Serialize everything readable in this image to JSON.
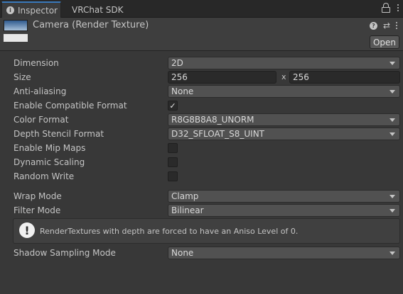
{
  "tabs": [
    {
      "label": "Inspector",
      "active": true
    },
    {
      "label": "VRChat SDK",
      "active": false
    }
  ],
  "header": {
    "title": "Camera (Render Texture)",
    "open_label": "Open"
  },
  "properties": {
    "dimension": {
      "label": "Dimension",
      "value": "2D"
    },
    "size": {
      "label": "Size",
      "width": "256",
      "separator": "x",
      "height": "256"
    },
    "anti_aliasing": {
      "label": "Anti-aliasing",
      "value": "None"
    },
    "enable_compatible_format": {
      "label": "Enable Compatible Format",
      "checked": true
    },
    "color_format": {
      "label": "Color Format",
      "value": "R8G8B8A8_UNORM"
    },
    "depth_stencil_format": {
      "label": "Depth Stencil Format",
      "value": "D32_SFLOAT_S8_UINT"
    },
    "enable_mip_maps": {
      "label": "Enable Mip Maps",
      "checked": false
    },
    "dynamic_scaling": {
      "label": "Dynamic Scaling",
      "checked": false
    },
    "random_write": {
      "label": "Random Write",
      "checked": false
    },
    "wrap_mode": {
      "label": "Wrap Mode",
      "value": "Clamp"
    },
    "filter_mode": {
      "label": "Filter Mode",
      "value": "Bilinear"
    },
    "shadow_sampling_mode": {
      "label": "Shadow Sampling Mode",
      "value": "None"
    }
  },
  "help": {
    "message": "RenderTextures with depth are forced to have an Aniso Level of 0."
  },
  "glyphs": {
    "info": "i",
    "help": "?",
    "sliders": "⇄",
    "check": "✓",
    "warning": "!"
  },
  "colors": {
    "background": "#383838",
    "tab_accent": "#3a79bb",
    "field": "#2a2a2a",
    "dropdown": "#515151",
    "text": "#c4c4c4"
  }
}
